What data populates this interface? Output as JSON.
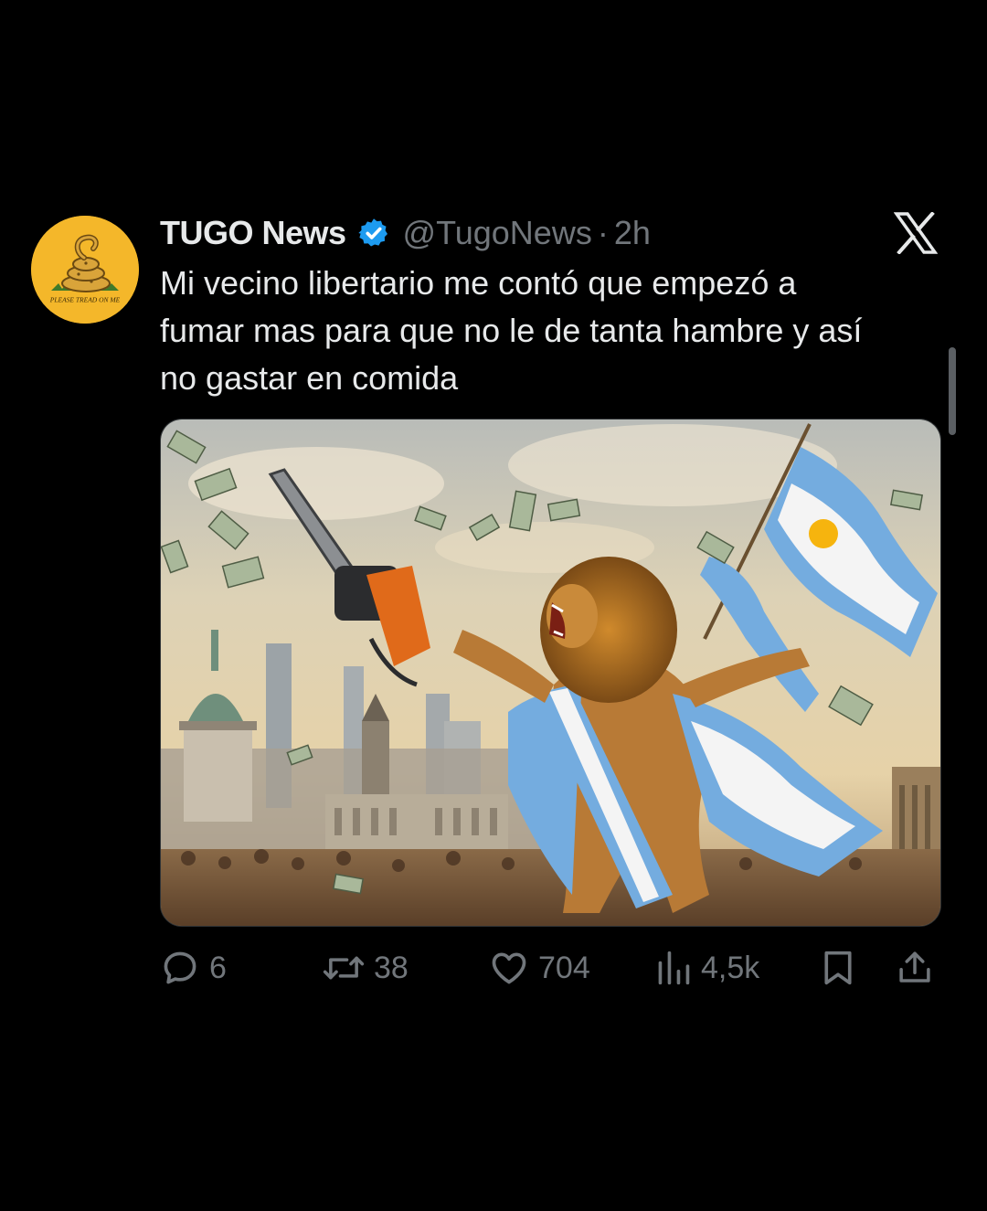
{
  "colors": {
    "background": "#000000",
    "text_primary": "#e7e9ea",
    "text_secondary": "#71767b",
    "verified_badge": "#1d9bf0",
    "avatar_bg": "#f4b72a"
  },
  "author": {
    "display_name": "TUGO News",
    "handle": "@TugoNews",
    "separator": "·",
    "time": "2h",
    "verified": true,
    "avatar_icon": "gadsden-snake-icon",
    "avatar_text": "PLEASE TREAD ON ME"
  },
  "platform_logo": "x-logo-icon",
  "tweet": {
    "text": "Mi vecino libertario me contó que empezó a\nfumar mas para que no le de tanta hambre y así\nno gastar en comida"
  },
  "media": {
    "type": "image",
    "subject": "lion-with-chainsaw-and-argentine-flag"
  },
  "actions": {
    "replies": "6",
    "retweets": "38",
    "likes": "704",
    "views": "4,5k",
    "bookmark_icon": "bookmark-icon",
    "share_icon": "share-icon"
  }
}
